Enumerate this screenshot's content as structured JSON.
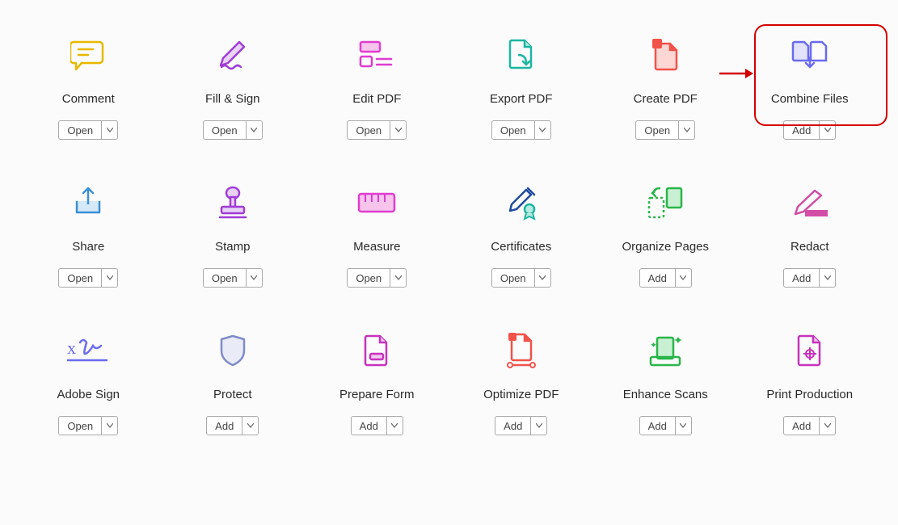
{
  "tools": [
    {
      "id": "comment",
      "label": "Comment",
      "button": "Open",
      "icon": "comment-icon"
    },
    {
      "id": "fill-sign",
      "label": "Fill & Sign",
      "button": "Open",
      "icon": "fill-sign-icon"
    },
    {
      "id": "edit-pdf",
      "label": "Edit PDF",
      "button": "Open",
      "icon": "edit-pdf-icon"
    },
    {
      "id": "export-pdf",
      "label": "Export PDF",
      "button": "Open",
      "icon": "export-pdf-icon"
    },
    {
      "id": "create-pdf",
      "label": "Create PDF",
      "button": "Open",
      "icon": "create-pdf-icon"
    },
    {
      "id": "combine-files",
      "label": "Combine Files",
      "button": "Add",
      "icon": "combine-files-icon"
    },
    {
      "id": "share",
      "label": "Share",
      "button": "Open",
      "icon": "share-icon"
    },
    {
      "id": "stamp",
      "label": "Stamp",
      "button": "Open",
      "icon": "stamp-icon"
    },
    {
      "id": "measure",
      "label": "Measure",
      "button": "Open",
      "icon": "measure-icon"
    },
    {
      "id": "certificates",
      "label": "Certificates",
      "button": "Open",
      "icon": "certificates-icon"
    },
    {
      "id": "organize-pages",
      "label": "Organize Pages",
      "button": "Add",
      "icon": "organize-pages-icon"
    },
    {
      "id": "redact",
      "label": "Redact",
      "button": "Add",
      "icon": "redact-icon"
    },
    {
      "id": "adobe-sign",
      "label": "Adobe Sign",
      "button": "Open",
      "icon": "adobe-sign-icon"
    },
    {
      "id": "protect",
      "label": "Protect",
      "button": "Add",
      "icon": "protect-icon"
    },
    {
      "id": "prepare-form",
      "label": "Prepare Form",
      "button": "Add",
      "icon": "prepare-form-icon"
    },
    {
      "id": "optimize-pdf",
      "label": "Optimize PDF",
      "button": "Add",
      "icon": "optimize-pdf-icon"
    },
    {
      "id": "enhance-scans",
      "label": "Enhance Scans",
      "button": "Add",
      "icon": "enhance-scans-icon"
    },
    {
      "id": "print-production",
      "label": "Print Production",
      "button": "Add",
      "icon": "print-production-icon"
    }
  ],
  "highlighted_tool": "combine-files",
  "colors": {
    "yellow": "#e8b800",
    "purple": "#a03cd6",
    "magenta": "#e03ccf",
    "teal": "#1cb5a2",
    "red": "#f1534a",
    "indigo": "#6b6bef",
    "blue": "#3a8fd8",
    "pink": "#d24da6",
    "navy": "#1f4aa0",
    "green": "#29b54a"
  }
}
